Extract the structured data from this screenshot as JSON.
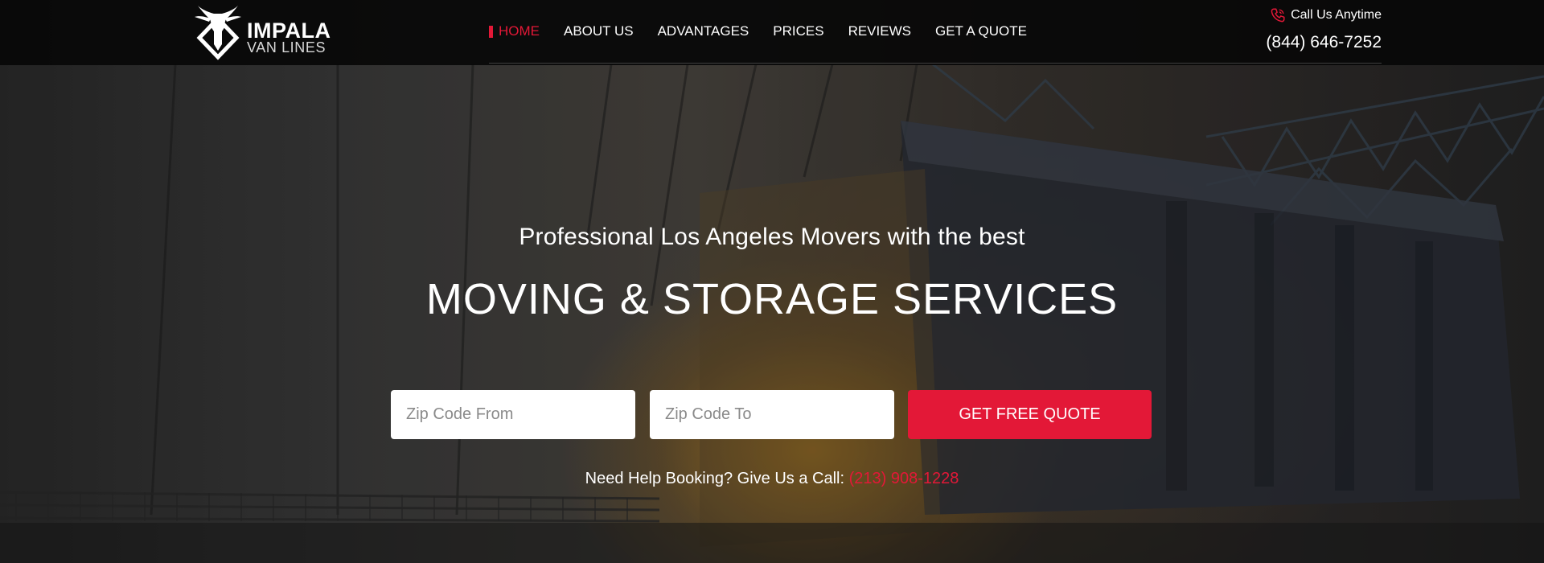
{
  "brand": {
    "name_line1": "IMPALA",
    "name_line2": "VAN LINES"
  },
  "nav": {
    "items": [
      {
        "label": "HOME",
        "active": true
      },
      {
        "label": "ABOUT US",
        "active": false
      },
      {
        "label": "ADVANTAGES",
        "active": false
      },
      {
        "label": "PRICES",
        "active": false
      },
      {
        "label": "REVIEWS",
        "active": false
      },
      {
        "label": "GET A QUOTE",
        "active": false
      }
    ]
  },
  "contact": {
    "label": "Call Us Anytime",
    "phone": "(844) 646-7252",
    "icon": "phone-icon"
  },
  "hero": {
    "subtitle": "Professional Los Angeles Movers with the best",
    "title": "MOVING & STORAGE SERVICES"
  },
  "form": {
    "zip_from_placeholder": "Zip Code From",
    "zip_from_value": "",
    "zip_to_placeholder": "Zip Code To",
    "zip_to_value": "",
    "submit_label": "GET FREE QUOTE"
  },
  "help": {
    "text": "Need Help Booking? Give Us a Call: ",
    "phone": "(213) 908-1228"
  },
  "colors": {
    "accent": "#e31837",
    "header_bg": "#080808",
    "text": "#ffffff"
  }
}
